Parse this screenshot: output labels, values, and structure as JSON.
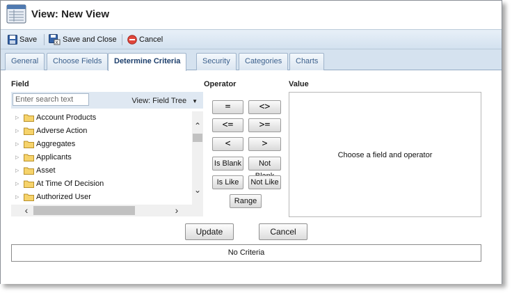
{
  "window": {
    "title": "View: New View"
  },
  "toolbar": {
    "save_label": "Save",
    "save_close_label": "Save and Close",
    "cancel_label": "Cancel"
  },
  "tabs": [
    {
      "label": "General"
    },
    {
      "label": "Choose Fields"
    },
    {
      "label": "Determine Criteria",
      "active": true
    },
    {
      "label": "Security"
    },
    {
      "label": "Categories"
    },
    {
      "label": "Charts"
    }
  ],
  "field": {
    "heading": "Field",
    "search_placeholder": "Enter search text",
    "view_label": "View: Field Tree",
    "tree_items": [
      "Account Products",
      "Adverse Action",
      "Aggregates",
      "Applicants",
      "Asset",
      "At Time Of Decision",
      "Authorized User"
    ]
  },
  "operator": {
    "heading": "Operator",
    "buttons": [
      "=",
      "<>",
      "<=",
      ">=",
      "<",
      ">",
      "Is Blank",
      "Not Blank",
      "Is Like",
      "Not Like",
      "Range"
    ]
  },
  "value": {
    "heading": "Value",
    "placeholder_message": "Choose a field and operator"
  },
  "actions": {
    "update_label": "Update",
    "cancel_label": "Cancel"
  },
  "criteria": {
    "empty_message": "No Criteria"
  },
  "colors": {
    "accent": "#3a5f8c",
    "tab_bg": "#d5e2ef",
    "toolbar_bg": "#dce7f2",
    "folder": "#f2c94c"
  }
}
